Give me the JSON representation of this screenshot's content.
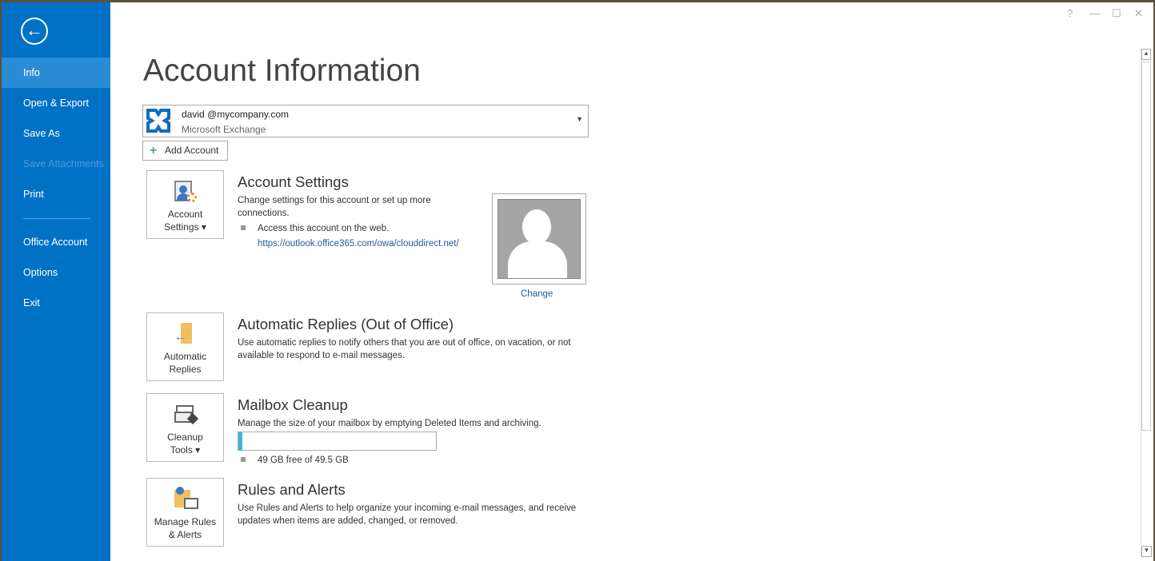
{
  "window": {
    "help": "?",
    "minimize": "—",
    "maximize": "☐",
    "close": "✕"
  },
  "sidebar": {
    "back": "←",
    "items": [
      {
        "label": "Info"
      },
      {
        "label": "Open & Export"
      },
      {
        "label": "Save As"
      },
      {
        "label": "Save Attachments"
      },
      {
        "label": "Print"
      },
      {
        "label": "Office Account"
      },
      {
        "label": "Options"
      },
      {
        "label": "Exit"
      }
    ]
  },
  "page_title": "Account Information",
  "account": {
    "email": "david @mycompany.com",
    "type": "Microsoft Exchange",
    "dropdown": "▼"
  },
  "add_account": {
    "icon": "+",
    "label": "Add Account"
  },
  "account_settings": {
    "tile_line1": "Account",
    "tile_line2": "Settings ▾",
    "title": "Account Settings",
    "desc": "Change settings for this account or set up more connections.",
    "bullet": "Access this account on the web.",
    "link": "https://outlook.office365.com/owa/clouddirect.net/",
    "change": "Change"
  },
  "auto_replies": {
    "tile_line1": "Automatic",
    "tile_line2": "Replies",
    "title": "Automatic Replies (Out of Office)",
    "desc": "Use automatic replies to notify others that you are out of office, on vacation, or not available to respond to e-mail messages."
  },
  "cleanup": {
    "tile_line1": "Cleanup",
    "tile_line2": "Tools ▾",
    "title": "Mailbox Cleanup",
    "desc": "Manage the size of your mailbox by emptying Deleted Items and archiving.",
    "used_fraction": 0.01,
    "free": "49 GB free of 49.5 GB",
    "bar_color": "#3cb4d8"
  },
  "rules": {
    "tile_line1": "Manage Rules",
    "tile_line2": "& Alerts",
    "title": "Rules and Alerts",
    "desc": "Use Rules and Alerts to help organize your incoming e-mail messages, and receive updates when items are added, changed, or removed."
  }
}
